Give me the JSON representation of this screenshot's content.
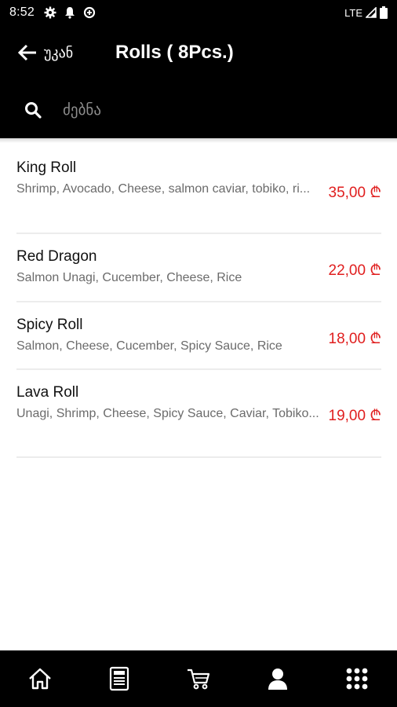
{
  "status": {
    "time": "8:52",
    "network": "LTE"
  },
  "app_bar": {
    "back_label": "უკან",
    "title": "Rolls ( 8Pcs.)"
  },
  "search": {
    "placeholder": "ძებნა"
  },
  "items": [
    {
      "name": "King Roll",
      "description": "Shrimp, Avocado, Cheese, salmon caviar, tobiko, ri...",
      "price": "35,00 ₾"
    },
    {
      "name": "Red Dragon",
      "description": "Salmon Unagi, Cucember, Cheese, Rice",
      "price": "22,00 ₾"
    },
    {
      "name": "Spicy Roll",
      "description": "Salmon, Cheese, Cucember, Spicy Sauce, Rice",
      "price": "18,00 ₾"
    },
    {
      "name": "Lava Roll",
      "description": "Unagi, Shrimp, Cheese, Spicy Sauce, Caviar, Tobiko...",
      "price": "19,00 ₾"
    }
  ],
  "bottom_nav": [
    "home-icon",
    "menu-card-icon",
    "cart-icon",
    "profile-icon",
    "apps-grid-icon"
  ],
  "colors": {
    "bar_background": "#000000",
    "price": "#e01e1e",
    "accent_text": "#ffffff"
  }
}
